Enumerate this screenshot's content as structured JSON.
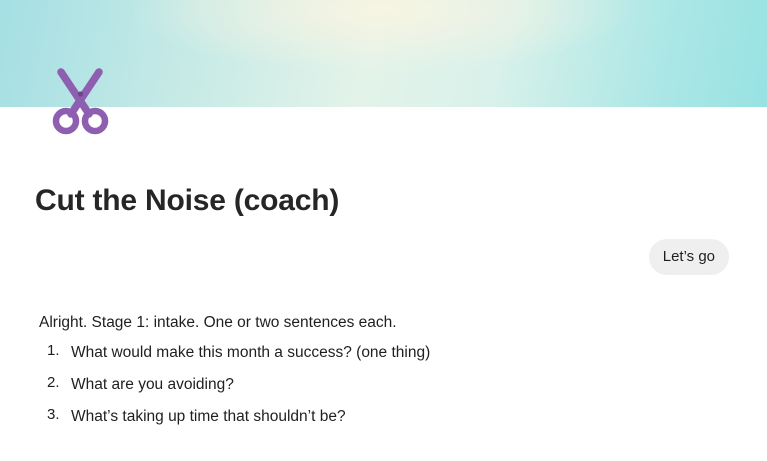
{
  "header": {
    "icon": "scissors-icon",
    "icon_color": "#8e5fb0",
    "title": "Cut the Noise (coach)"
  },
  "conversation": {
    "user_message": "Let’s go",
    "assistant_reply": {
      "intro": "Alright. Stage 1: intake. One or two sentences each.",
      "items": [
        {
          "number": "1.",
          "text": "What would make this month a success? (one thing)"
        },
        {
          "number": "2.",
          "text": "What are you avoiding?"
        },
        {
          "number": "3.",
          "text": "What’s taking up time that shouldn’t be?"
        }
      ]
    }
  }
}
